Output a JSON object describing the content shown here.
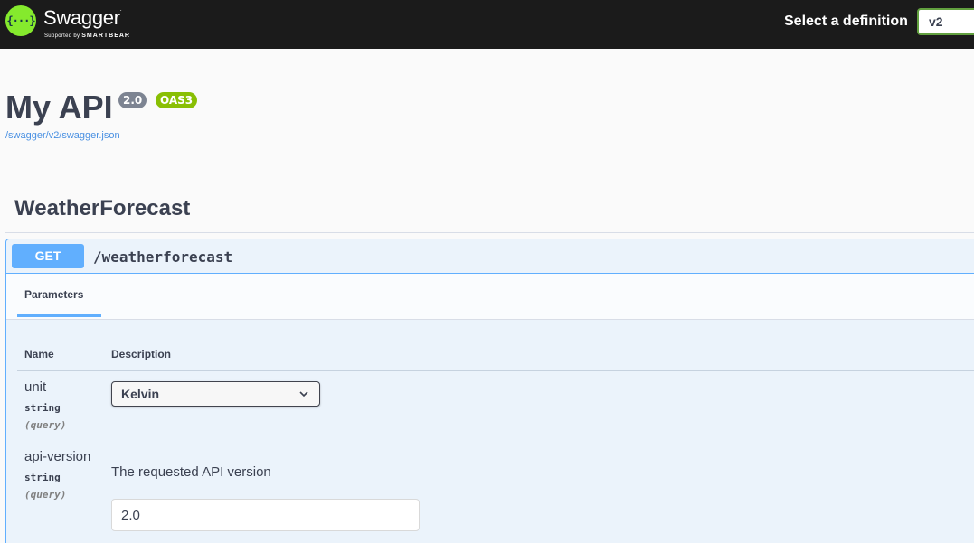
{
  "topbar": {
    "brand": "Swagger",
    "brand_sub_prefix": "Supported by",
    "brand_sub_name": "SMARTBEAR",
    "logo_glyph": "{···}",
    "definition_label": "Select a definition",
    "definition_value": "v2"
  },
  "info": {
    "title": "My API",
    "version_badge": "2.0",
    "oas_badge": "OAS3",
    "spec_url": "/swagger/v2/swagger.json"
  },
  "tag": {
    "name": "WeatherForecast"
  },
  "operation": {
    "method": "GET",
    "path": "/weatherforecast",
    "tab_label": "Parameters",
    "columns": {
      "name": "Name",
      "description": "Description"
    },
    "parameters": [
      {
        "name": "unit",
        "type": "string",
        "in": "(query)",
        "selected_value": "Kelvin"
      },
      {
        "name": "api-version",
        "type": "string",
        "in": "(query)",
        "description": "The requested API version",
        "value": "2.0"
      }
    ]
  },
  "colors": {
    "topbar_bg": "#1b1b1b",
    "swagger_green": "#85ea2d",
    "get_blue": "#61affe",
    "oas_green": "#89bf04",
    "version_gray": "#7d8492",
    "link_blue": "#4990e2"
  },
  "icons": {
    "logo": "swagger-logo-icon",
    "select_chevron": "chevron-down-icon"
  }
}
